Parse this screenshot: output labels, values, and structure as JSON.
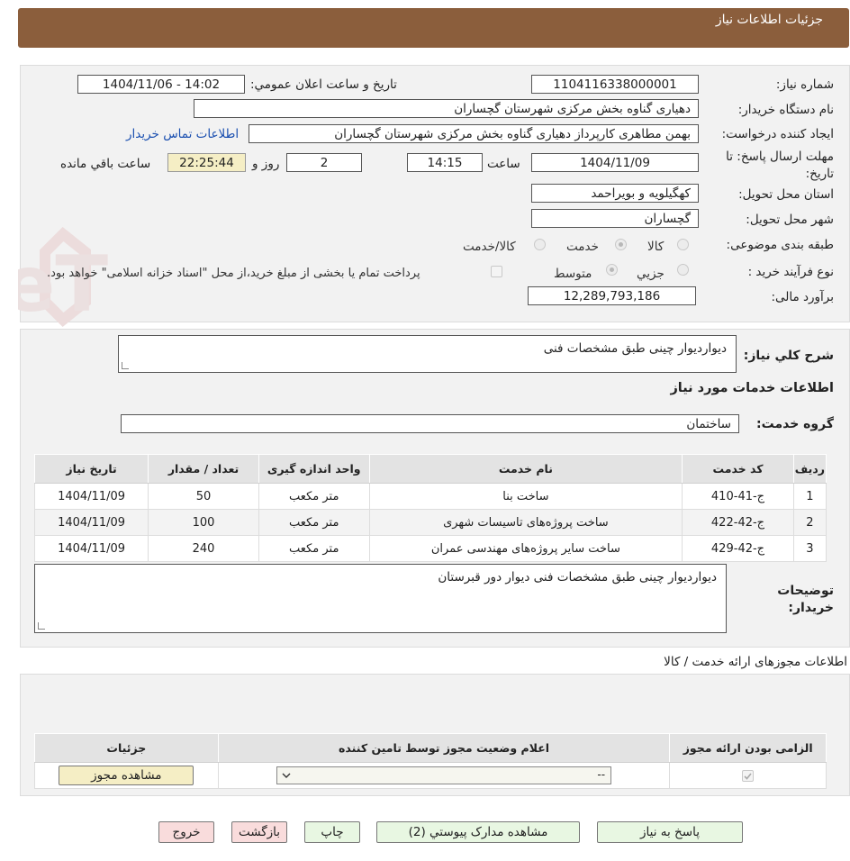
{
  "header": {
    "title": "جزئيات اطلاعات نياز"
  },
  "fields": {
    "need_number_label": "شماره نياز:",
    "need_number": "1104116338000001",
    "announce_label": "تاريخ و ساعت اعلان عمومي:",
    "announce_value": "1404/11/06 - 14:02",
    "buyer_org_label": "نام دستگاه خريدار:",
    "buyer_org": "دهیاری گناوه بخش مرکزی شهرستان گچساران",
    "creator_label": "ايجاد كننده درخواست:",
    "creator": "بهمن مطاهری کارپرداز دهیاری گناوه بخش مرکزی شهرستان گچساران",
    "contact_link": "اطلاعات تماس خريدار",
    "deadline_label_1": "مهلت ارسال پاسخ: تا",
    "deadline_label_2": "تاريخ:",
    "deadline_date": "1404/11/09",
    "time_label": "ساعت",
    "deadline_time": "14:15",
    "days_value": "2",
    "days_label": "روز و",
    "remaining_time": "22:25:44",
    "remaining_label": "ساعت باقي مانده",
    "province_label": "استان محل تحويل:",
    "province": "کهگیلویه و بویراحمد",
    "city_label": "شهر محل تحويل:",
    "city": "گچساران",
    "category_label": "طبقه بندی موضوعی:",
    "category_options": [
      "كالا",
      "خدمت",
      "كالا/خدمت"
    ],
    "process_label": "نوع فرآيند خريد :",
    "process_options": [
      "جزيي",
      "متوسط"
    ],
    "payment_note": "پرداخت تمام يا بخشی از مبلغ خريد،از محل \"اسناد خزانه اسلامی\" خواهد بود.",
    "estimate_label": "برآورد مالی:",
    "estimate": "12,289,793,186"
  },
  "description": {
    "label": "شرح كلي نياز:",
    "value": "دیواردیوار چینی طبق مشخصات فنی"
  },
  "services": {
    "section_title": "اطلاعات خدمات مورد نياز",
    "group_label": "گروه خدمت:",
    "group_value": "ساختمان",
    "columns": [
      "رديف",
      "كد خدمت",
      "نام خدمت",
      "واحد اندازه گيری",
      "تعداد / مقدار",
      "تاريخ نياز"
    ],
    "rows": [
      [
        "1",
        "ج-41-410",
        "ساخت بنا",
        "متر مکعب",
        "50",
        "1404/11/09"
      ],
      [
        "2",
        "ج-42-422",
        "ساخت پروژه‌های تاسیسات شهری",
        "متر مکعب",
        "100",
        "1404/11/09"
      ],
      [
        "3",
        "ج-42-429",
        "ساخت سایر پروژه‌های مهندسی عمران",
        "متر مکعب",
        "240",
        "1404/11/09"
      ]
    ]
  },
  "buyer_notes": {
    "label_1": "توضيحات",
    "label_2": "خريدار:",
    "value": "دیواردیوار چینی طبق مشخصات فنی دیوار دور قبرستان"
  },
  "permits": {
    "title": "اطلاعات مجوزهای ارائه خدمت / كالا",
    "columns": [
      "الزامی بودن ارائه مجوز",
      "اعلام وضعيت مجوز توسط تامين كننده",
      "جزئيات"
    ],
    "select_value": "--",
    "view_button": "مشاهده مجوز"
  },
  "actions": {
    "reply": "پاسخ به نياز",
    "attachments": "مشاهده مدارک پيوستي (2)",
    "print": "چاپ",
    "back": "بازگشت",
    "exit": "خروج"
  },
  "watermark": {
    "text": "AriaTender.neT"
  },
  "colors": {
    "header": "#8b5e3c",
    "link": "#1a4fb0",
    "highlight": "#f5eec5",
    "green_btn": "#e8f7e2",
    "pink_btn": "#f9dcdc"
  }
}
